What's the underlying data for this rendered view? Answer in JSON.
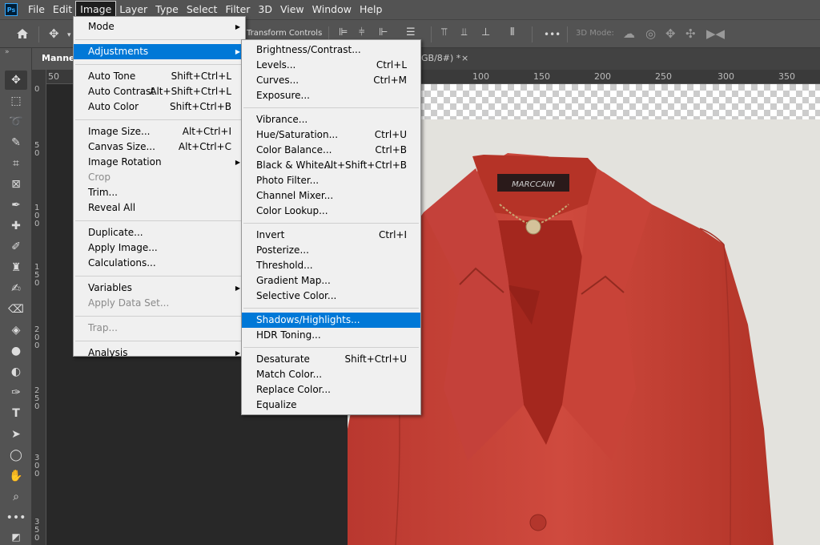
{
  "app": {
    "logo": "Ps"
  },
  "menubar": [
    "File",
    "Edit",
    "Image",
    "Layer",
    "Type",
    "Select",
    "Filter",
    "3D",
    "View",
    "Window",
    "Help"
  ],
  "menubar_active": "Image",
  "options_bar": {
    "transform_controls": "Transform Controls",
    "mode_3d": "3D Mode:",
    "more": "•••"
  },
  "document": {
    "tab_name": "Manneq",
    "tab_suffix": "GB/8#) *",
    "close": "×"
  },
  "rulers": {
    "top": [
      "50",
      "100",
      "150",
      "200",
      "250",
      "300",
      "350"
    ],
    "left": [
      "0",
      "5 0",
      "1 0 0",
      "1 5 0",
      "2 0 0",
      "2 5 0",
      "3 0 0",
      "3 5 0"
    ]
  },
  "image_menu": {
    "items": [
      {
        "label": "Mode",
        "submenu": true
      },
      {
        "sep": true
      },
      {
        "label": "Adjustments",
        "submenu": true,
        "highlighted": true
      },
      {
        "sep": true
      },
      {
        "label": "Auto Tone",
        "shortcut": "Shift+Ctrl+L"
      },
      {
        "label": "Auto Contrast",
        "shortcut": "Alt+Shift+Ctrl+L"
      },
      {
        "label": "Auto Color",
        "shortcut": "Shift+Ctrl+B"
      },
      {
        "sep": true
      },
      {
        "label": "Image Size...",
        "shortcut": "Alt+Ctrl+I"
      },
      {
        "label": "Canvas Size...",
        "shortcut": "Alt+Ctrl+C"
      },
      {
        "label": "Image Rotation",
        "submenu": true
      },
      {
        "label": "Crop",
        "disabled": true
      },
      {
        "label": "Trim..."
      },
      {
        "label": "Reveal All"
      },
      {
        "sep": true
      },
      {
        "label": "Duplicate..."
      },
      {
        "label": "Apply Image..."
      },
      {
        "label": "Calculations..."
      },
      {
        "sep": true
      },
      {
        "label": "Variables",
        "submenu": true
      },
      {
        "label": "Apply Data Set...",
        "disabled": true
      },
      {
        "sep": true
      },
      {
        "label": "Trap...",
        "disabled": true
      },
      {
        "sep": true
      },
      {
        "label": "Analysis",
        "submenu": true
      }
    ]
  },
  "adjustments_menu": {
    "items": [
      {
        "label": "Brightness/Contrast..."
      },
      {
        "label": "Levels...",
        "shortcut": "Ctrl+L"
      },
      {
        "label": "Curves...",
        "shortcut": "Ctrl+M"
      },
      {
        "label": "Exposure..."
      },
      {
        "sep": true
      },
      {
        "label": "Vibrance..."
      },
      {
        "label": "Hue/Saturation...",
        "shortcut": "Ctrl+U"
      },
      {
        "label": "Color Balance...",
        "shortcut": "Ctrl+B"
      },
      {
        "label": "Black & White...",
        "shortcut": "Alt+Shift+Ctrl+B"
      },
      {
        "label": "Photo Filter..."
      },
      {
        "label": "Channel Mixer..."
      },
      {
        "label": "Color Lookup..."
      },
      {
        "sep": true
      },
      {
        "label": "Invert",
        "shortcut": "Ctrl+I"
      },
      {
        "label": "Posterize..."
      },
      {
        "label": "Threshold..."
      },
      {
        "label": "Gradient Map..."
      },
      {
        "label": "Selective Color..."
      },
      {
        "sep": true
      },
      {
        "label": "Shadows/Highlights...",
        "highlighted": true
      },
      {
        "label": "HDR Toning..."
      },
      {
        "sep": true
      },
      {
        "label": "Desaturate",
        "shortcut": "Shift+Ctrl+U"
      },
      {
        "label": "Match Color..."
      },
      {
        "label": "Replace Color..."
      },
      {
        "label": "Equalize"
      }
    ]
  },
  "jacket_label": "MARCCAIN",
  "colors": {
    "chrome": "#535353",
    "menu_bg": "#f0f0f0",
    "highlight": "#0078d7",
    "jacket": "#c8443a"
  }
}
